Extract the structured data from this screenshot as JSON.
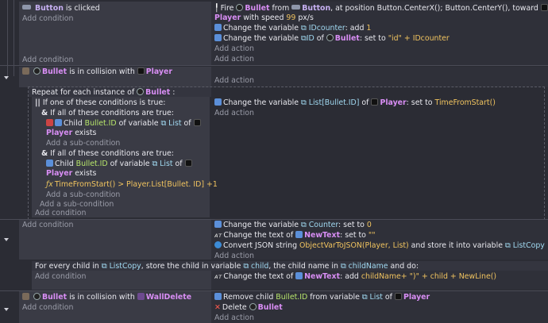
{
  "event1": {
    "cond_btn_name": "Button",
    "cond_text": "is clicked",
    "add_condition": "Add condition",
    "action1": {
      "verb": "Fire",
      "obj": "Bullet",
      "from": "from",
      "btn": "Button",
      "rest": ", at position Button.CenterX(); Button.CenterY(), toward",
      "player": "Player",
      "speed_pre": "with speed",
      "speed": "99",
      "unit": "px/s"
    },
    "action2": {
      "pre": "Change the variable",
      "var": "IDcounter",
      "mid": ": add",
      "val": "1"
    },
    "action3": {
      "pre": "Change the variable",
      "var": "ID",
      "of": "of",
      "obj": "Bullet",
      "mid": ": set to",
      "str": "\"id\"",
      "plus": "+ IDcounter"
    },
    "add_action": "Add action"
  },
  "outer_add_condition": "Add condition",
  "outer_add_action": "Add action",
  "event2": {
    "obj": "Bullet",
    "mid": "is in collision with",
    "target": "Player",
    "add_action": "Add action"
  },
  "repeat": {
    "label_pre": "Repeat for each instance of",
    "obj": "Bullet",
    "label_post": ":",
    "or_label": "If one of these conditions is true:",
    "and1_label": "If all of these conditions are true:",
    "child1": {
      "pre": "Child",
      "val": "Bullet.ID",
      "mid": "of variable",
      "var": "List",
      "of": "of"
    },
    "child1_player": "Player",
    "child1_exists": "exists",
    "add_sub1": "Add a sub-condition",
    "and2_label": "If all of these conditions are true:",
    "child2": {
      "pre": "Child",
      "val": "Bullet.ID",
      "mid": "of variable",
      "var": "List",
      "of": "of"
    },
    "child2_player": "Player",
    "child2_exists": "exists",
    "time_expr": "TimeFromStart() > Player.List[Bullet. ID] +1",
    "add_sub2": "Add a sub-condition",
    "add_sub3": "Add a sub-condition",
    "add_condition": "Add condition",
    "action": {
      "pre": "Change the variable",
      "var": "List[Bullet.ID]",
      "of": "of",
      "obj": "Player",
      "mid": ": set to",
      "val": "TimeFromStart()"
    },
    "add_action": "Add action"
  },
  "event3": {
    "add_condition": "Add condition",
    "a1": {
      "pre": "Change the variable",
      "var": "Counter",
      "mid": ": set to",
      "val": "0"
    },
    "a2": {
      "pre": "Change the text of",
      "obj": "NewText",
      "mid": ": set to",
      "str": "\"\""
    },
    "a3": {
      "pre": "Convert JSON string",
      "val": "ObjectVarToJSON(Player, List)",
      "mid": "and store it into variable",
      "var": "ListCopy"
    },
    "add_action": "Add action"
  },
  "foreach": {
    "pre": "For every child in",
    "var": "ListCopy",
    "mid": ", store the child in variable",
    "var2": "child",
    "mid2": ", the child name in",
    "var3": "childName",
    "post": "and do:",
    "add_condition": "Add condition",
    "action": {
      "pre": "Change the text of",
      "obj": "NewText",
      "mid": ": add",
      "val": "childName+ \")\" + child + NewLine()"
    }
  },
  "event4": {
    "obj": "Bullet",
    "mid": "is in collision with",
    "target": "WallDelete",
    "add_condition": "Add condition",
    "a1": {
      "pre": "Remove child",
      "val": "Bullet.ID",
      "mid": "from variable",
      "var": "List",
      "of": "of",
      "obj": "Player"
    },
    "a2": {
      "pre": "Delete",
      "obj": "Bullet"
    },
    "add_action": "Add action"
  }
}
